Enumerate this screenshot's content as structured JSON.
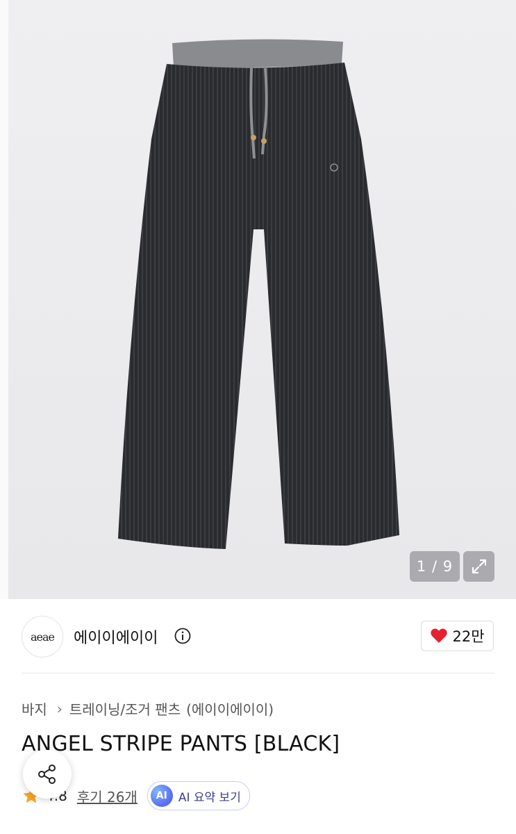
{
  "gallery": {
    "counter": "1 / 9",
    "image_alt": "ANGEL STRIPE PANTS [BLACK]"
  },
  "brand": {
    "logo_text": "aeae",
    "name": "에이이에이이",
    "like_count": "22만"
  },
  "breadcrumb": {
    "category": "바지",
    "subcategory": "트레이닝/조거 팬츠",
    "brand": "(에이이에이이)"
  },
  "product": {
    "title": "ANGEL STRIPE PANTS [BLACK]",
    "rating": "4.8",
    "reviews": "후기 26개",
    "ai_summary_label": "AI 요약 보기",
    "ai_badge": "AI"
  },
  "colors": {
    "heart": "#e8202f",
    "star": "#f5a623",
    "accent_ai": "#5a6cf0"
  }
}
